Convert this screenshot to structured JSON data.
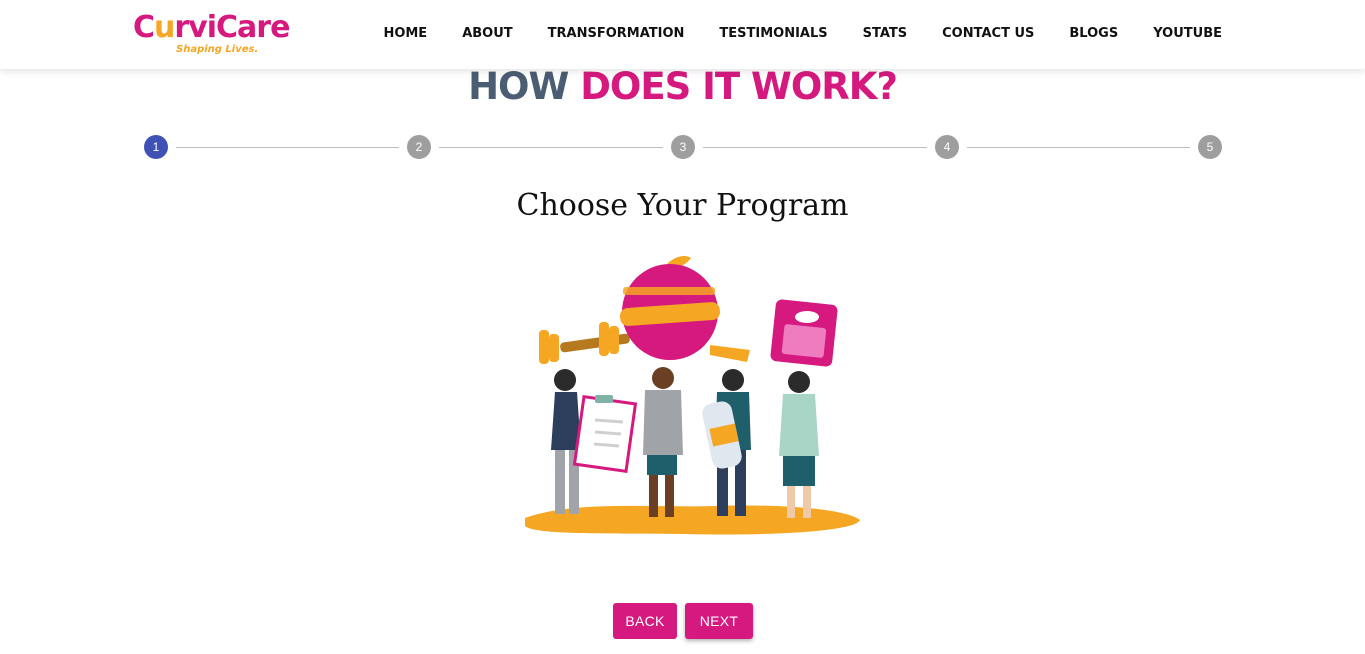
{
  "brand": {
    "logo_text_start": "C",
    "logo_text_u": "u",
    "logo_text_end": "rviCare",
    "tagline": "Shaping Lives.",
    "colors": {
      "pink": "#d6197f",
      "orange": "#f5a623",
      "slate": "#4b5d73"
    }
  },
  "nav": {
    "items": [
      {
        "label": "HOME"
      },
      {
        "label": "ABOUT"
      },
      {
        "label": "TRANSFORMATION"
      },
      {
        "label": "TESTIMONIALS"
      },
      {
        "label": "STATS"
      },
      {
        "label": "CONTACT US"
      },
      {
        "label": "BLOGS"
      },
      {
        "label": "YOUTUBE"
      }
    ]
  },
  "section": {
    "title_part1": "HOW",
    "title_part2": "DOES IT WORK?"
  },
  "stepper": {
    "active_step": 1,
    "steps": [
      {
        "label": "1"
      },
      {
        "label": "2"
      },
      {
        "label": "3"
      },
      {
        "label": "4"
      },
      {
        "label": "5"
      }
    ],
    "active_color": "#3f51b5",
    "inactive_color": "#9e9e9e"
  },
  "step_content": {
    "heading": "Choose Your Program",
    "illustration_icon": "fitness-group-illustration"
  },
  "buttons": {
    "back_label": "BACK",
    "next_label": "NEXT"
  }
}
